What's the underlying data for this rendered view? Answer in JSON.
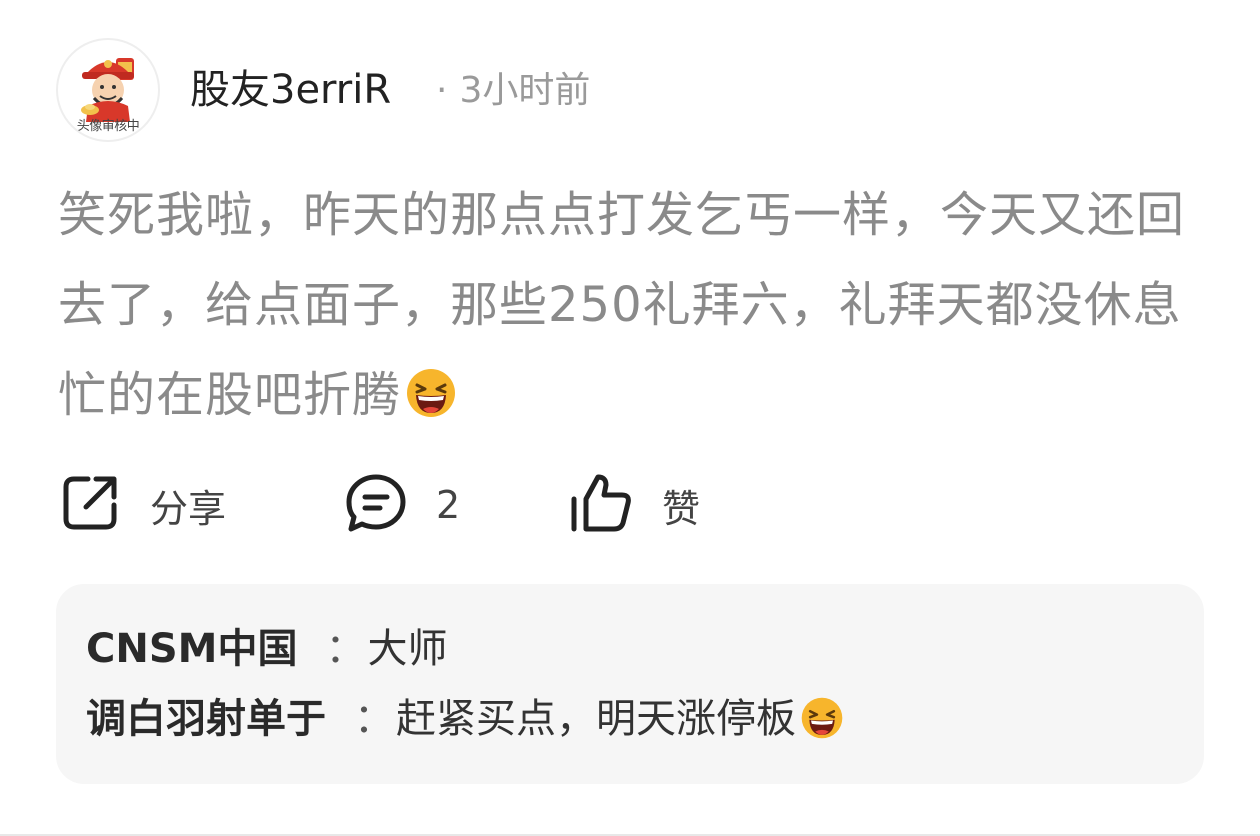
{
  "post": {
    "avatar_badge": "头像审核中",
    "author": "股友3erriR",
    "dot": "·",
    "time": "3小时前",
    "content": "笑死我啦，昨天的那点点打发乞丐一样，今天又还回去了，给点面子，那些250礼拜六，礼拜天都没休息忙的在股吧折腾",
    "content_emoji": "laughing-emoji"
  },
  "actions": {
    "share_label": "分享",
    "share_icon": "share-icon",
    "comment_count": "2",
    "comment_icon": "comment-icon",
    "like_label": "赞",
    "like_icon": "thumbs-up-icon"
  },
  "replies": [
    {
      "name": "CNSM中国",
      "sep": "：",
      "text": "大师",
      "emoji": ""
    },
    {
      "name": "调白羽射单于",
      "sep": "：",
      "text": "赶紧买点，明天涨停板",
      "emoji": "laughing-emoji"
    }
  ],
  "colors": {
    "author": "#222222",
    "meta": "#9a9a9a",
    "content": "#8a8a8a",
    "reply_bg": "#f6f6f6"
  }
}
